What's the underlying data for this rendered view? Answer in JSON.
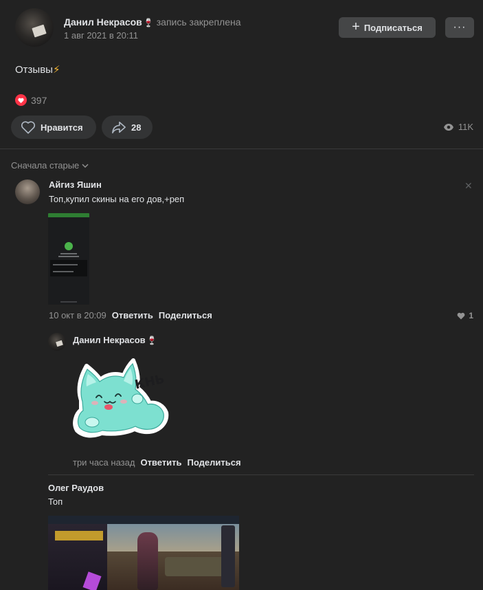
{
  "post": {
    "author": "Данил Некрасов",
    "author_emoji": "🍷",
    "pinned_label": "запись закреплена",
    "date": "1 авг 2021 в 20:11",
    "subscribe_label": "Подписаться",
    "more_label": "···",
    "text": "Отзывы",
    "text_emoji": "⚡",
    "reactions_count": "397",
    "like_label": "Нравится",
    "share_count": "28",
    "views": "11K"
  },
  "comments_sort": "Сначала старые",
  "comments": [
    {
      "author": "Айгиз Яшин",
      "text": "Топ,купил скины на его дов,+реп",
      "time": "10 окт в 20:09",
      "reply_label": "Ответить",
      "share_label": "Поделиться",
      "likes": "1",
      "close_label": "✕"
    },
    {
      "author": "Данил Некрасов",
      "author_emoji": "🍷",
      "sticker_text": "КНЬ",
      "time": "три часа назад",
      "reply_label": "Ответить",
      "share_label": "Поделиться"
    },
    {
      "author": "Олег Раудов",
      "text": "Топ"
    }
  ],
  "colors": {
    "background": "#222222",
    "button": "#454647",
    "action_button": "#333435",
    "text": "#e1e3e6",
    "muted": "#939393",
    "like_red": "#ff3347"
  }
}
